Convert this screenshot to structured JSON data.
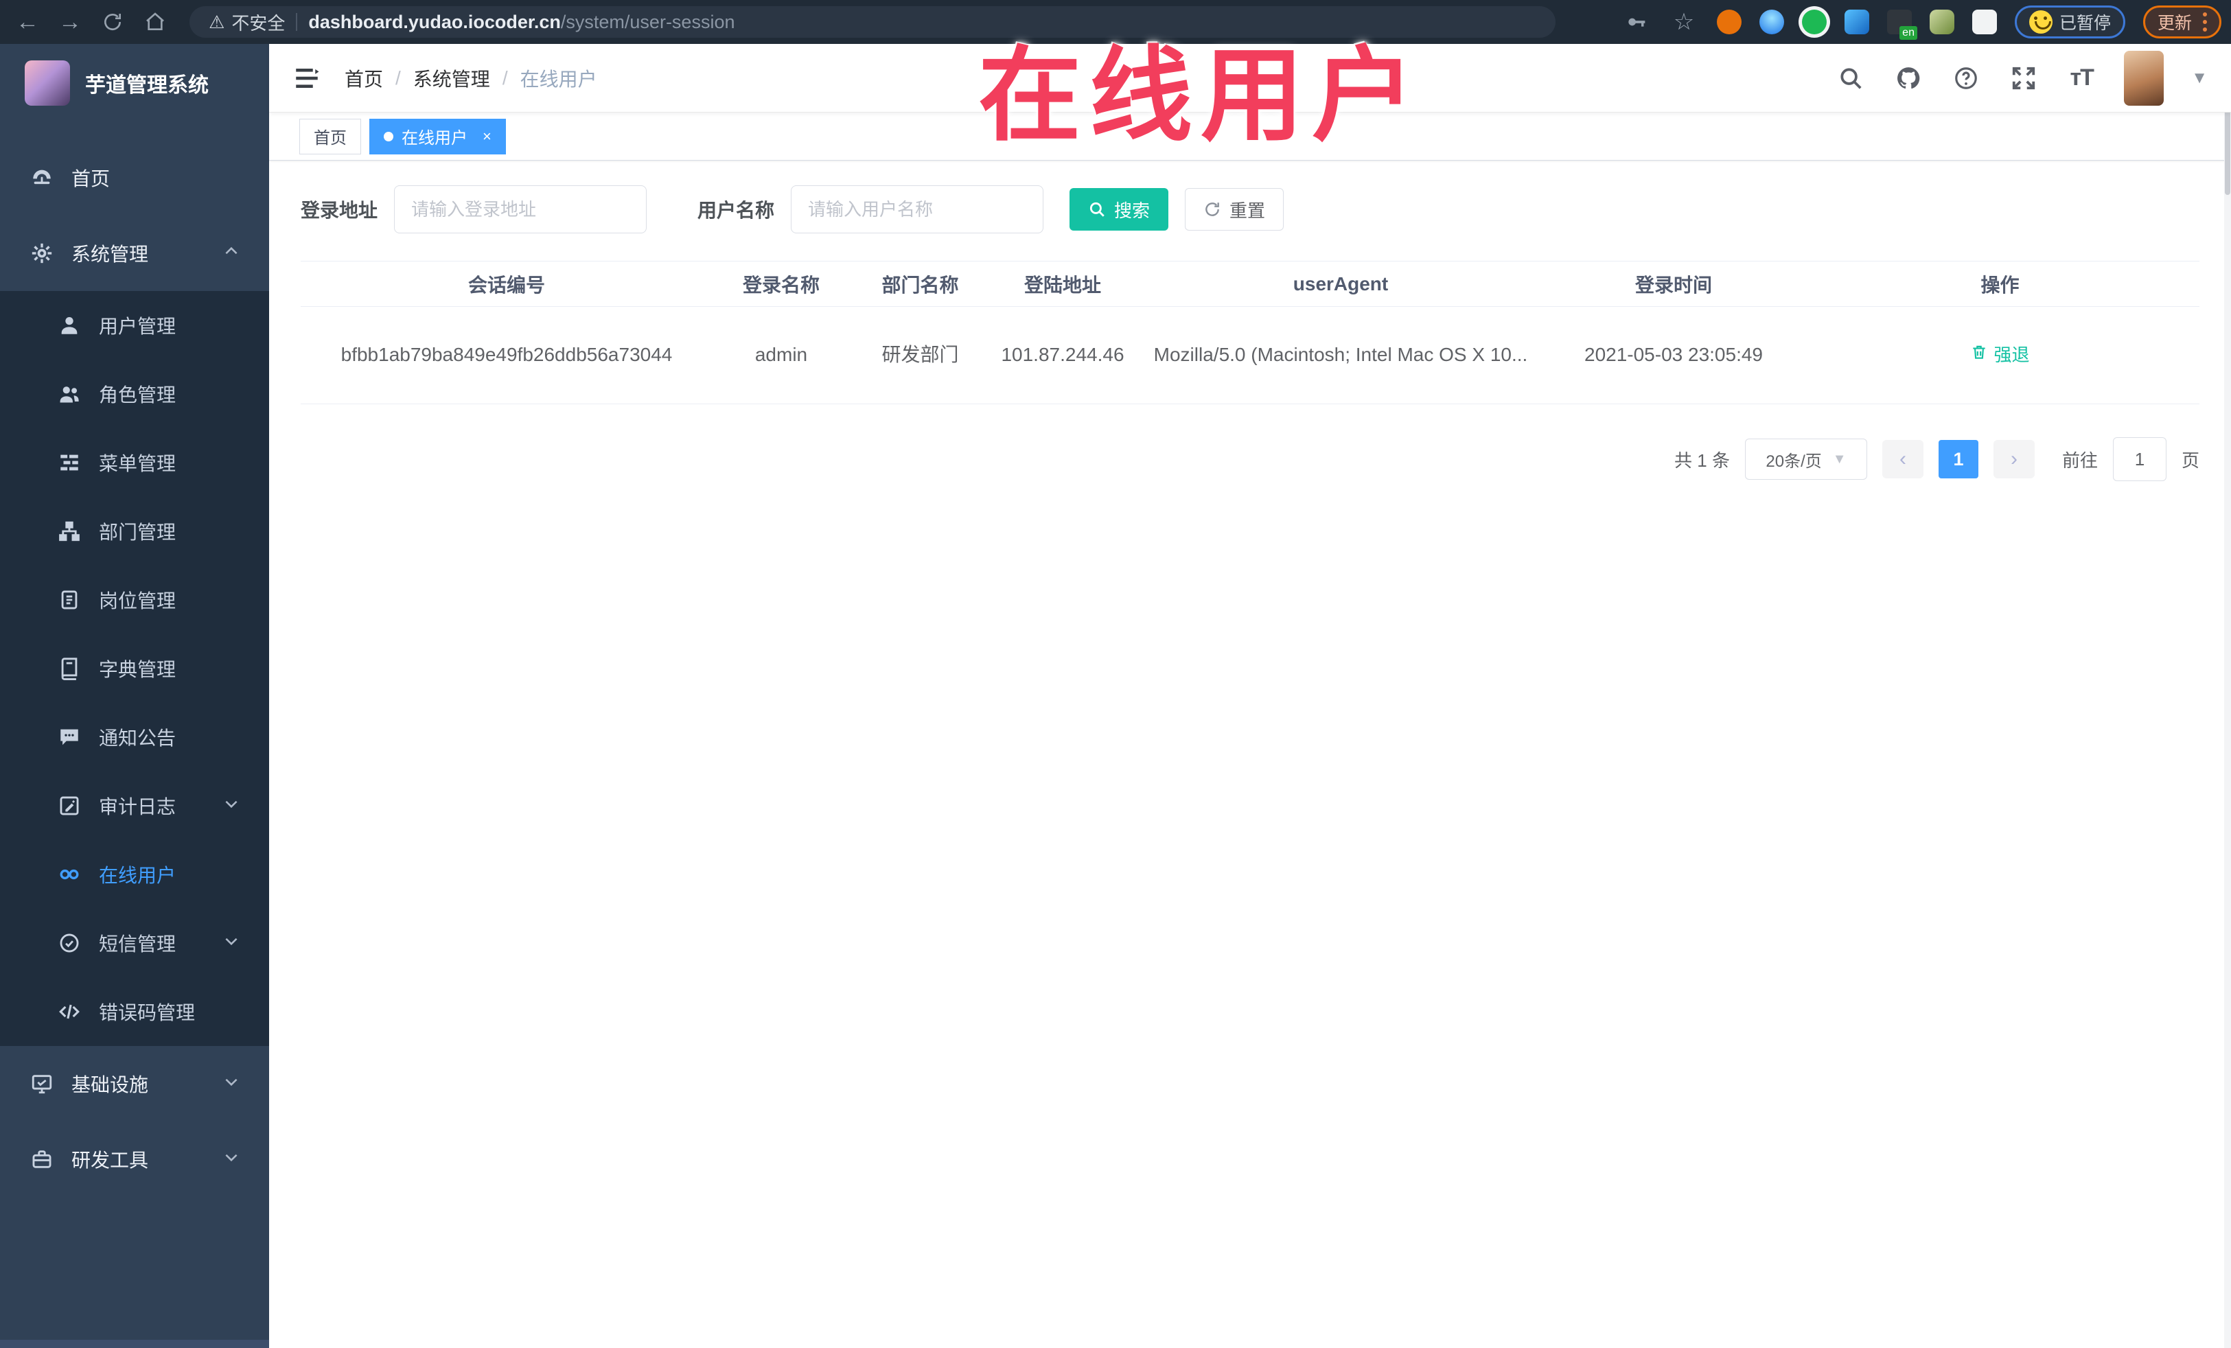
{
  "browser": {
    "security_label": "不安全",
    "url_domain": "dashboard.yudao.iocoder.cn",
    "url_path": "/system/user-session",
    "en_badge": "en",
    "paused_label": "已暂停",
    "update_label": "更新"
  },
  "watermark": {
    "text": "在线用户",
    "color": "#f23e5c"
  },
  "sidebar": {
    "title": "芋道管理系统",
    "items": [
      {
        "label": "首页",
        "icon": "dashboard-icon",
        "level": "top"
      },
      {
        "label": "系统管理",
        "icon": "gear-icon",
        "level": "top",
        "chevron": "up"
      },
      {
        "label": "用户管理",
        "icon": "user-icon",
        "level": "sub"
      },
      {
        "label": "角色管理",
        "icon": "peoples-icon",
        "level": "sub"
      },
      {
        "label": "菜单管理",
        "icon": "tree-table-icon",
        "level": "sub"
      },
      {
        "label": "部门管理",
        "icon": "tree-icon",
        "level": "sub"
      },
      {
        "label": "岗位管理",
        "icon": "post-icon",
        "level": "sub"
      },
      {
        "label": "字典管理",
        "icon": "dict-icon",
        "level": "sub"
      },
      {
        "label": "通知公告",
        "icon": "message-icon",
        "level": "sub"
      },
      {
        "label": "审计日志",
        "icon": "log-icon",
        "level": "sub",
        "chevron": "down"
      },
      {
        "label": "在线用户",
        "icon": "online-icon",
        "level": "sub",
        "active": true
      },
      {
        "label": "短信管理",
        "icon": "sms-icon",
        "level": "sub",
        "chevron": "down"
      },
      {
        "label": "错误码管理",
        "icon": "code-icon",
        "level": "sub"
      },
      {
        "label": "基础设施",
        "icon": "monitor-icon",
        "level": "top",
        "chevron": "down"
      },
      {
        "label": "研发工具",
        "icon": "tool-icon",
        "level": "top",
        "chevron": "down"
      }
    ]
  },
  "header": {
    "breadcrumb": [
      "首页",
      "系统管理",
      "在线用户"
    ]
  },
  "tags": [
    {
      "label": "首页",
      "active": false
    },
    {
      "label": "在线用户",
      "active": true,
      "closable": true
    }
  ],
  "filters": {
    "login_address_label": "登录地址",
    "login_address_placeholder": "请输入登录地址",
    "username_label": "用户名称",
    "username_placeholder": "请输入用户名称",
    "search_label": "搜索",
    "reset_label": "重置"
  },
  "table": {
    "columns": [
      "会话编号",
      "登录名称",
      "部门名称",
      "登陆地址",
      "userAgent",
      "登录时间",
      "操作"
    ],
    "rows": [
      {
        "session_id": "bfbb1ab79ba849e49fb26ddb56a73044",
        "username": "admin",
        "dept": "研发部门",
        "ip": "101.87.244.46",
        "user_agent": "Mozilla/5.0 (Macintosh; Intel Mac OS X 10...",
        "login_time": "2021-05-03 23:05:49",
        "action": "强退"
      }
    ]
  },
  "pagination": {
    "total_label": "共 1 条",
    "page_size_label": "20条/页",
    "prev_glyph": "‹",
    "next_glyph": "›",
    "current_page": "1",
    "goto_label": "前往",
    "goto_value": "1",
    "page_unit_label": "页"
  },
  "colors": {
    "primary_blue": "#409EFF",
    "accent_teal": "#14c1a3",
    "sidebar_bg": "#304156",
    "submenu_bg": "#1f2d3d",
    "watermark_red": "#f23e5c"
  }
}
